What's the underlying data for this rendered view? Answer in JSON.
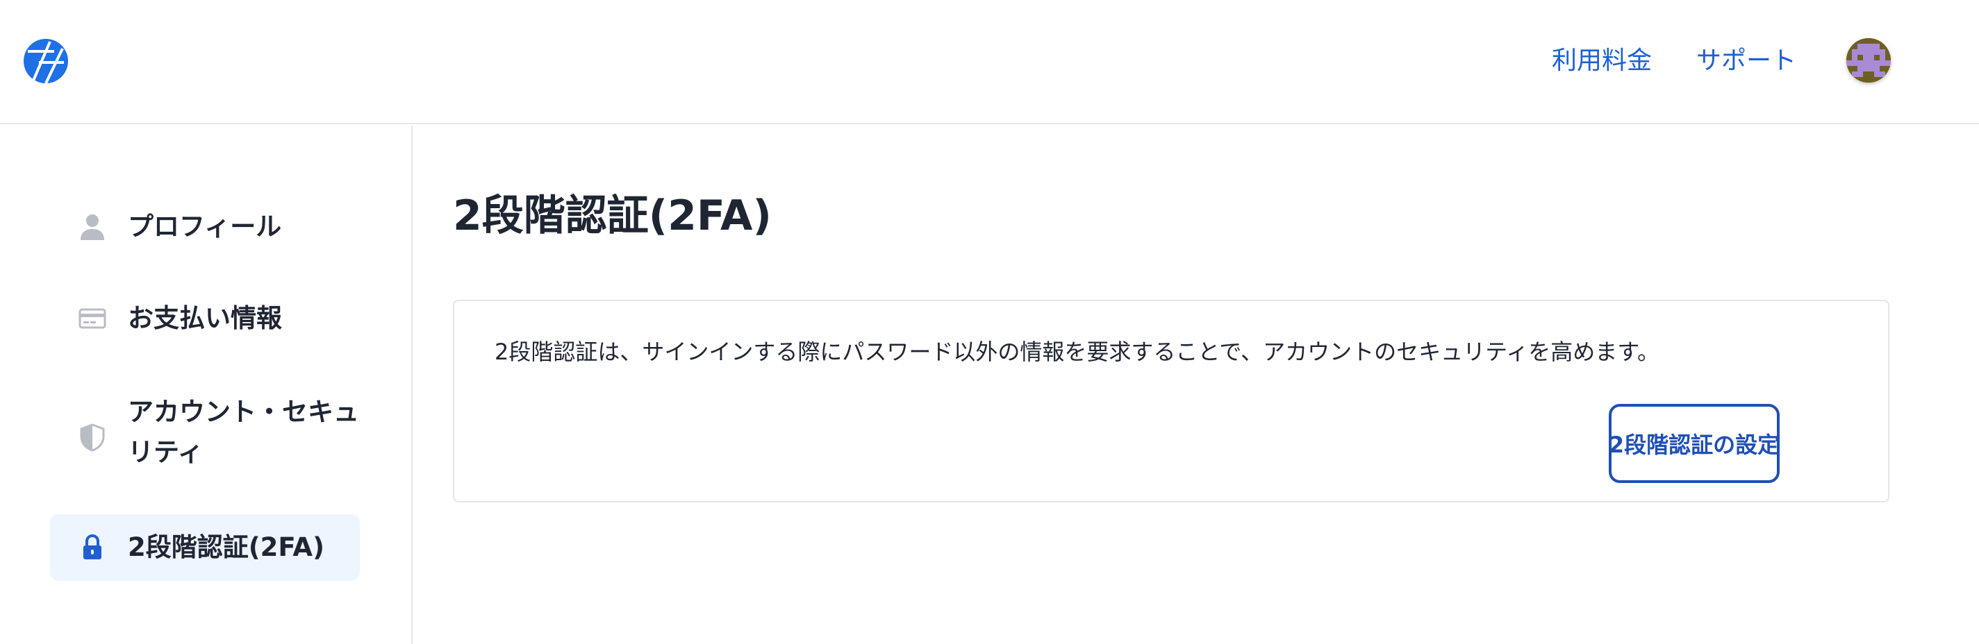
{
  "header": {
    "logo_icon": "logo-icon",
    "nav": {
      "pricing_label": "利用料金",
      "support_label": "サポート"
    },
    "avatar_icon": "pixel-avatar"
  },
  "sidebar": {
    "items": [
      {
        "label": "プロフィール",
        "icon": "person-icon",
        "active": false
      },
      {
        "label": "お支払い情報",
        "icon": "credit-card-icon",
        "active": false
      },
      {
        "label": "アカウント・セキュリティ",
        "icon": "shield-icon",
        "active": false
      },
      {
        "label": "2段階認証(2FA)",
        "icon": "lock-icon",
        "active": true
      }
    ]
  },
  "main": {
    "title": "2段階認証(2FA)",
    "card": {
      "description": "2段階認証は、サインインする際にパスワード以外の情報を要求することで、アカウントのセキュリティを高めます。",
      "button_label": "2段階認証の設定"
    }
  },
  "colors": {
    "accent": "#1f5fd1",
    "button_border": "#1f4fb6",
    "active_item_bg": "#edf5fe",
    "text": "#1f2633",
    "muted_icon": "#b8bcc4",
    "border": "#e4e6ea"
  }
}
